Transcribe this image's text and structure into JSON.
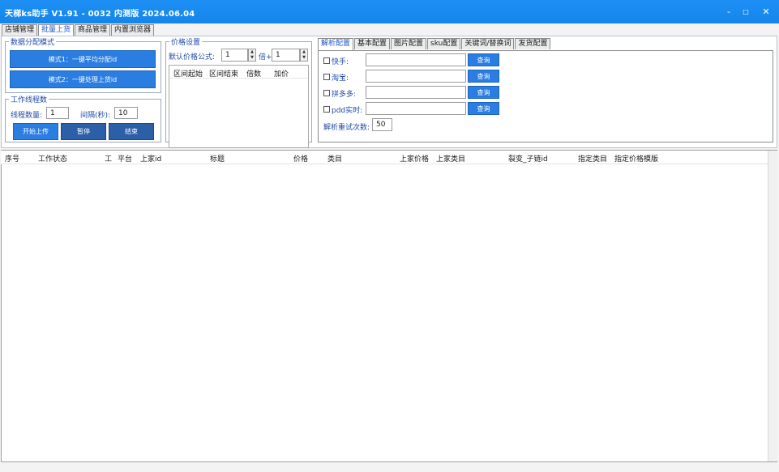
{
  "window": {
    "title": "天梯ks助手 V1.91 - 0032 内测版 2024.06.04",
    "minimize": "-",
    "maximize": "□",
    "close": "✕"
  },
  "main_tabs": [
    {
      "label": "店铺管理",
      "active": false
    },
    {
      "label": "批量上货",
      "active": true
    },
    {
      "label": "商品管理",
      "active": false
    },
    {
      "label": "内置浏览器",
      "active": false
    }
  ],
  "assign_mode": {
    "legend": "数据分配模式",
    "mode1": "模式1：一键平均分配id",
    "mode2": "模式2：一键处理上货id"
  },
  "threads": {
    "legend": "工作线程数",
    "thread_count_label": "线程数量:",
    "thread_count_value": "1",
    "interval_label": "间隔(秒):",
    "interval_value": "10",
    "start": "开始上传",
    "pause": "暂停",
    "stop": "结束"
  },
  "price": {
    "legend": "价格设置",
    "formula_label": "默认价格公式:",
    "multiplier_value": "1",
    "times_plus": "倍+",
    "add_value": "1",
    "table_headers": [
      "区间起始",
      "区间结束",
      "倍数",
      "加价"
    ]
  },
  "config_tabs": [
    {
      "label": "解析配置",
      "active": true
    },
    {
      "label": "基本配置",
      "active": false
    },
    {
      "label": "图片配置",
      "active": false
    },
    {
      "label": "sku配置",
      "active": false
    },
    {
      "label": "关键词/替换词",
      "active": false
    },
    {
      "label": "发货配置",
      "active": false
    }
  ],
  "parse": {
    "rows": [
      {
        "label": "快手:",
        "value": "",
        "button": "查询",
        "checked": false
      },
      {
        "label": "淘宝:",
        "value": "",
        "button": "查询",
        "checked": false
      },
      {
        "label": "拼多多:",
        "value": "",
        "button": "查询",
        "checked": false
      },
      {
        "label": "pdd实时:",
        "value": "",
        "button": "查询",
        "checked": false
      }
    ],
    "retry_label": "解析重试次数:",
    "retry_value": "50"
  },
  "grid": {
    "columns": [
      "序号",
      "工作状态",
      "工",
      "平台",
      "上家id",
      "标题",
      "价格",
      "类目",
      "上家价格",
      "上家类目",
      "裂变_子链id",
      "指定类目",
      "指定价格模版"
    ]
  }
}
